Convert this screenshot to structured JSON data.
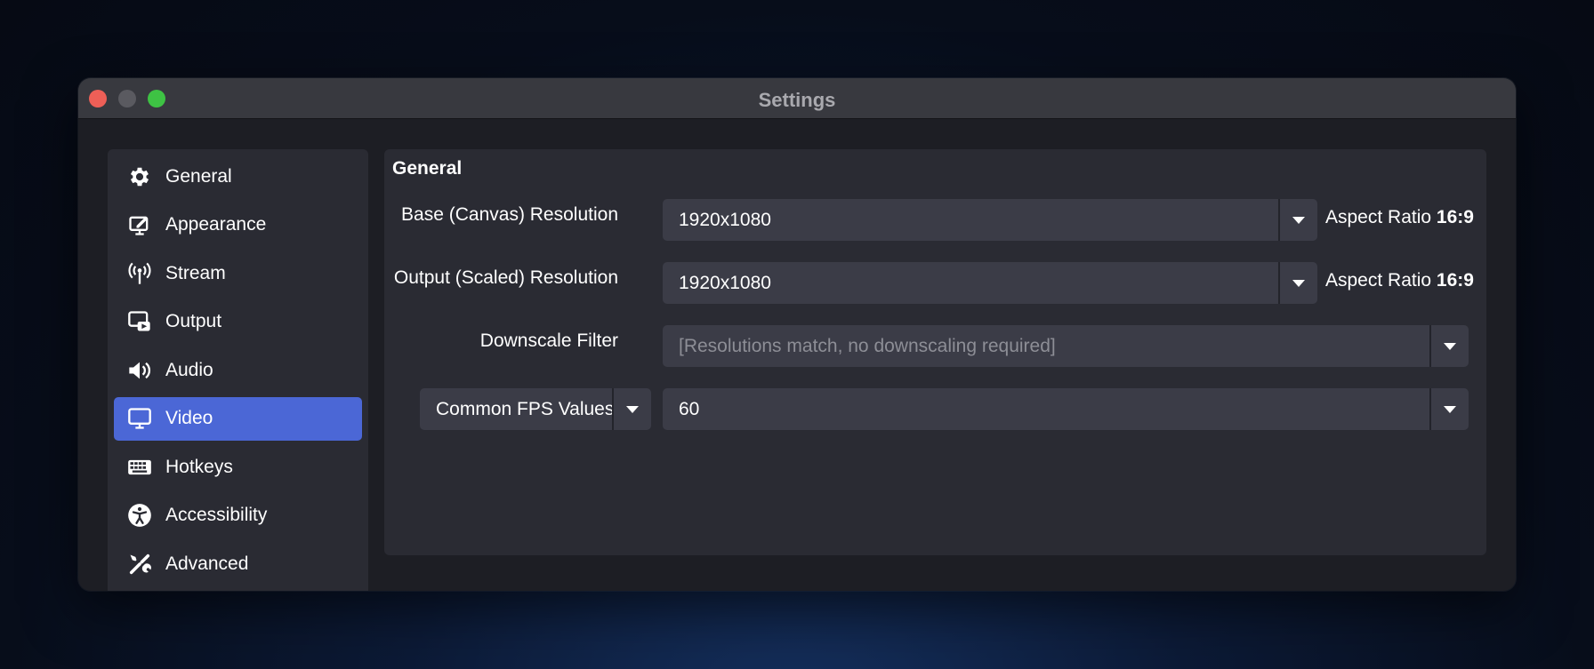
{
  "window": {
    "title": "Settings"
  },
  "sidebar": {
    "items": [
      {
        "label": "General",
        "icon": "gear-icon",
        "active": false
      },
      {
        "label": "Appearance",
        "icon": "appearance-icon",
        "active": false
      },
      {
        "label": "Stream",
        "icon": "antenna-icon",
        "active": false
      },
      {
        "label": "Output",
        "icon": "output-icon",
        "active": false
      },
      {
        "label": "Audio",
        "icon": "speaker-icon",
        "active": false
      },
      {
        "label": "Video",
        "icon": "monitor-icon",
        "active": true
      },
      {
        "label": "Hotkeys",
        "icon": "keyboard-icon",
        "active": false
      },
      {
        "label": "Accessibility",
        "icon": "accessibility-icon",
        "active": false
      },
      {
        "label": "Advanced",
        "icon": "tools-icon",
        "active": false
      }
    ]
  },
  "content": {
    "section_title": "General",
    "base_resolution": {
      "label": "Base (Canvas) Resolution",
      "value": "1920x1080",
      "aspect_label": "Aspect Ratio",
      "aspect_value": "16:9"
    },
    "output_resolution": {
      "label": "Output (Scaled) Resolution",
      "value": "1920x1080",
      "aspect_label": "Aspect Ratio",
      "aspect_value": "16:9"
    },
    "downscale_filter": {
      "label": "Downscale Filter",
      "placeholder": "[Resolutions match, no downscaling required]"
    },
    "fps": {
      "type_value": "Common FPS Values",
      "value": "60"
    }
  },
  "colors": {
    "accent": "#4b67d6",
    "close": "#ee5f57",
    "maximize": "#3ec244",
    "panel": "#2a2b33",
    "field": "#3b3c47"
  }
}
